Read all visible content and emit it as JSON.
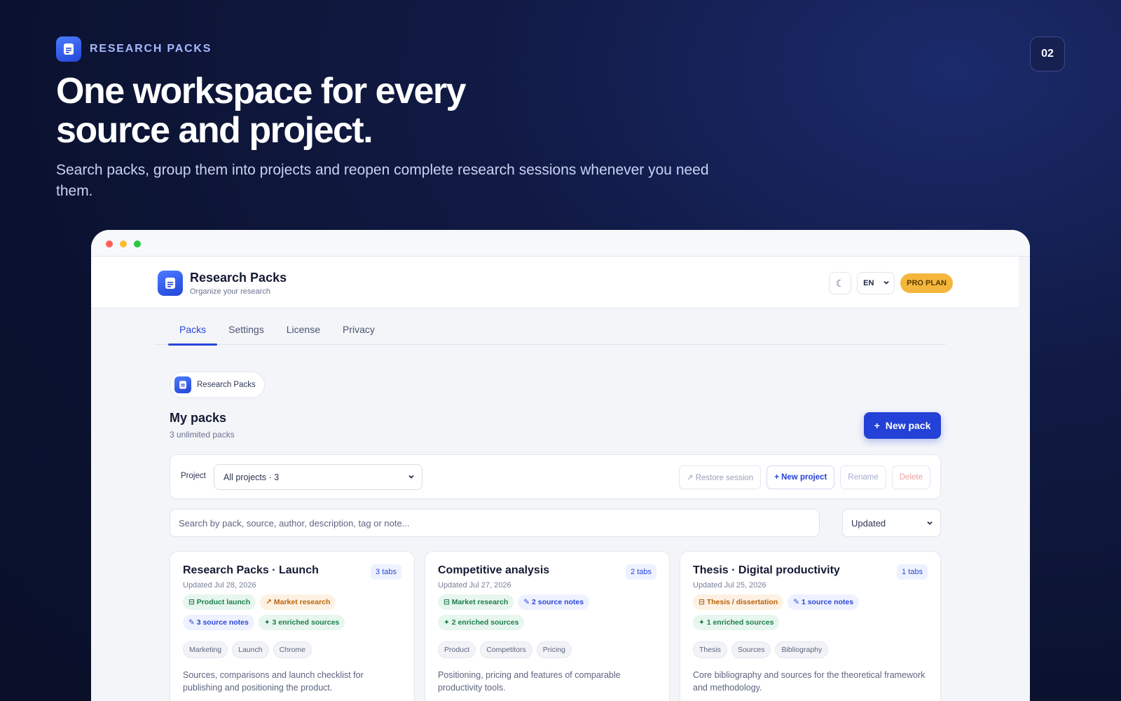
{
  "hero": {
    "eyebrow": "RESEARCH PACKS",
    "title": "One workspace for every source and project.",
    "subtitle": "Search packs, group them into projects and reopen complete research sessions whenever you need them.",
    "page_number": "02"
  },
  "app": {
    "title": "Research Packs",
    "subtitle": "Organize your research",
    "theme_icon": "moon-icon",
    "language": "EN",
    "plan_badge": "PRO PLAN"
  },
  "tabs": [
    {
      "label": "Packs",
      "active": true
    },
    {
      "label": "Settings",
      "active": false
    },
    {
      "label": "License",
      "active": false
    },
    {
      "label": "Privacy",
      "active": false
    }
  ],
  "breadcrumb": {
    "label": "Research Packs"
  },
  "packs": {
    "title": "My packs",
    "subtitle": "3 unlimited packs",
    "new_pack_label": "New pack"
  },
  "filter": {
    "project_label": "Project",
    "project_value": "All projects · 3",
    "restore_label": "↗ Restore session",
    "new_project_label": "+ New project",
    "rename_label": "Rename",
    "delete_label": "Delete"
  },
  "search": {
    "placeholder": "Search by pack, source, author, description, tag or note...",
    "sort_value": "Updated"
  },
  "cards": [
    {
      "title": "Research Packs · Launch",
      "tabs": "3 tabs",
      "updated": "Updated Jul 28, 2026",
      "badges": [
        {
          "text": "⊟ Product launch",
          "color": "green"
        },
        {
          "text": "↗ Market research",
          "color": "orange"
        },
        {
          "text": "✎ 3 source notes",
          "color": "blue"
        },
        {
          "text": "✦ 3 enriched sources",
          "color": "green"
        }
      ],
      "tags": [
        "Marketing",
        "Launch",
        "Chrome"
      ],
      "description": "Sources, comparisons and launch checklist for publishing and positioning the product."
    },
    {
      "title": "Competitive analysis",
      "tabs": "2 tabs",
      "updated": "Updated Jul 27, 2026",
      "badges": [
        {
          "text": "⊟ Market research",
          "color": "green"
        },
        {
          "text": "✎ 2 source notes",
          "color": "blue"
        },
        {
          "text": "✦ 2 enriched sources",
          "color": "green"
        }
      ],
      "tags": [
        "Product",
        "Competitors",
        "Pricing"
      ],
      "description": "Positioning, pricing and features of comparable productivity tools."
    },
    {
      "title": "Thesis · Digital productivity",
      "tabs": "1 tabs",
      "updated": "Updated Jul 25, 2026",
      "badges": [
        {
          "text": "⊟ Thesis / dissertation",
          "color": "orange"
        },
        {
          "text": "✎ 1 source notes",
          "color": "blue"
        },
        {
          "text": "✦ 1 enriched sources",
          "color": "green"
        }
      ],
      "tags": [
        "Thesis",
        "Sources",
        "Bibliography"
      ],
      "description": "Core bibliography and sources for the theoretical framework and methodology."
    }
  ],
  "colors": {
    "accent": "#2341d6",
    "pro_badge": "#f4b63c",
    "background": "#0b1230"
  }
}
